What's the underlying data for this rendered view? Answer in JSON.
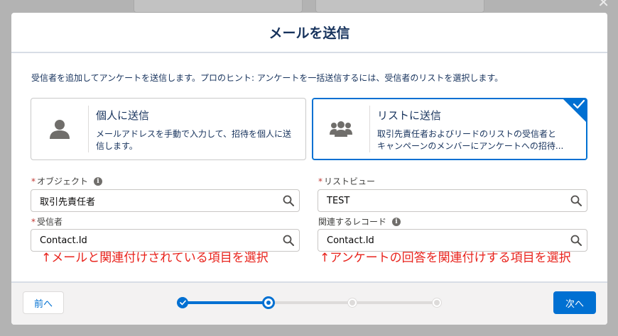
{
  "background": {
    "close_glyph": "✕"
  },
  "modal": {
    "title": "メールを送信",
    "intro": "受信者を追加してアンケートを送信します。プロのヒント: アンケートを一括送信するには、受信者のリストを選択します。"
  },
  "options": {
    "personal": {
      "title": "個人に送信",
      "desc": "メールアドレスを手動で入力して、招待を個人に送信します。",
      "icon": "user-icon"
    },
    "list": {
      "title": "リストに送信",
      "desc_line1": "取引先責任者およびリードのリストの受信者と",
      "desc_line2": "キャンペーンのメンバーにアンケートへの招待...",
      "icon": "groups-icon",
      "selected": true
    }
  },
  "fields": {
    "object": {
      "label": "オブジェクト",
      "required": "*",
      "value": "取引先責任者"
    },
    "list_view": {
      "label": "リストビュー",
      "required": "*",
      "value": "TEST"
    },
    "recipient": {
      "label": "受信者",
      "required": "*",
      "value": "Contact.Id"
    },
    "related_record": {
      "label": "関連するレコード",
      "value": "Contact.Id"
    },
    "info_glyph": "i"
  },
  "annotations": {
    "left": "↑メールと関連付けされている項目を選択",
    "right": "↑アンケートの回答を関連付けする項目を選択"
  },
  "footer": {
    "prev_label": "前へ",
    "next_label": "次へ",
    "progress": {
      "total_steps": 4,
      "completed_steps": 1,
      "current_step": 2
    }
  },
  "colors": {
    "brand": "#0070d2",
    "annotation": "#e8231c",
    "title": "#16325c"
  }
}
